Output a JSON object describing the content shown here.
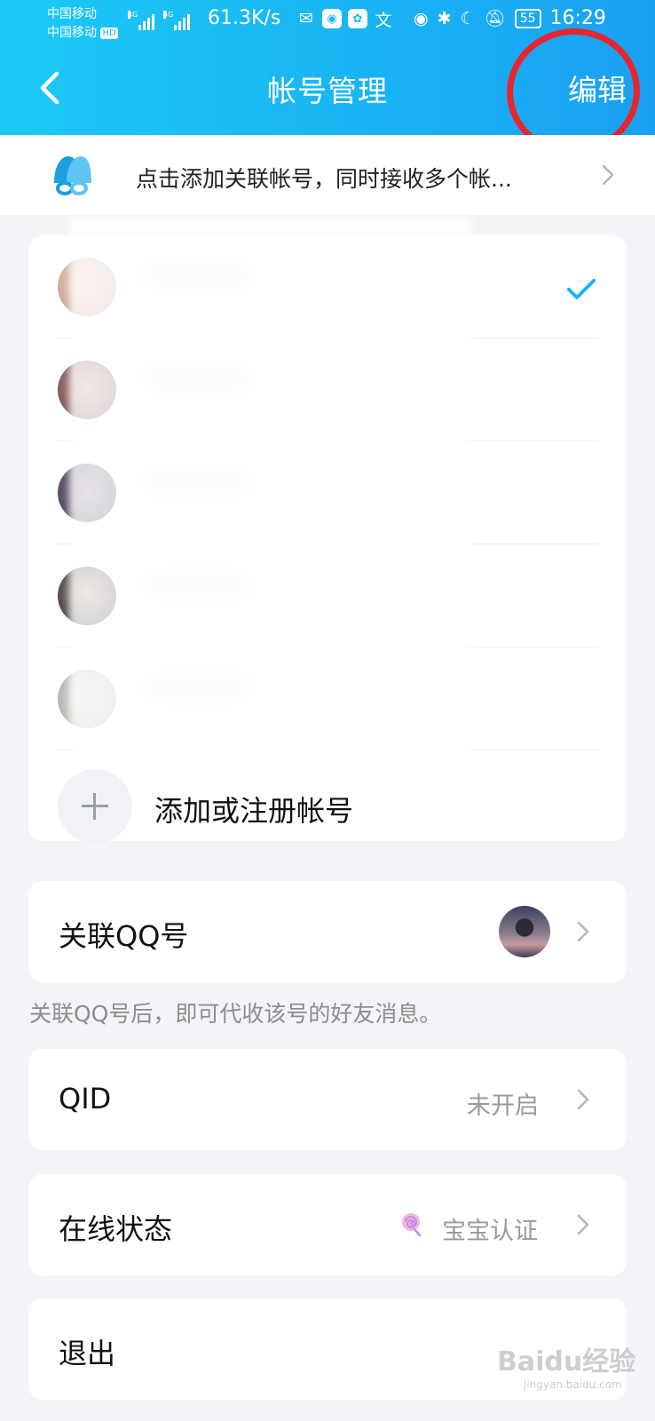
{
  "status_bar": {
    "carrier_1": "中国移动",
    "carrier_2": "中国移动",
    "hd_badge": "HD",
    "network_1": "4G",
    "network_2": "4G",
    "speed": "61.3K/s",
    "battery": "55",
    "time": "16:29"
  },
  "header": {
    "title": "帐号管理",
    "edit_label": "编辑",
    "back_icon": "chevron-left-icon",
    "highlight_color": "#e8242d"
  },
  "banner": {
    "text": "点击添加关联帐号，同时接收多个帐...",
    "icon": "linked-accounts-icon"
  },
  "accounts": {
    "count_visible": 5,
    "current_checked_index": 0,
    "add_label": "添加或注册帐号"
  },
  "linked_qq": {
    "label": "关联QQ号",
    "note": "关联QQ号后，即可代收该号的好友消息。"
  },
  "qid": {
    "label": "QID",
    "value": "未开启"
  },
  "online_status": {
    "label": "在线状态",
    "value": "宝宝认证",
    "icon": "lollipop-icon"
  },
  "logout": {
    "label": "退出"
  },
  "watermark": {
    "main": "Baidu经验",
    "sub": "jingyan.baidu.com"
  },
  "colors": {
    "header_start": "#1cc9f5",
    "header_end": "#1aa0f2",
    "accent": "#1ab6f4",
    "page_bg": "#f2f4f7"
  }
}
